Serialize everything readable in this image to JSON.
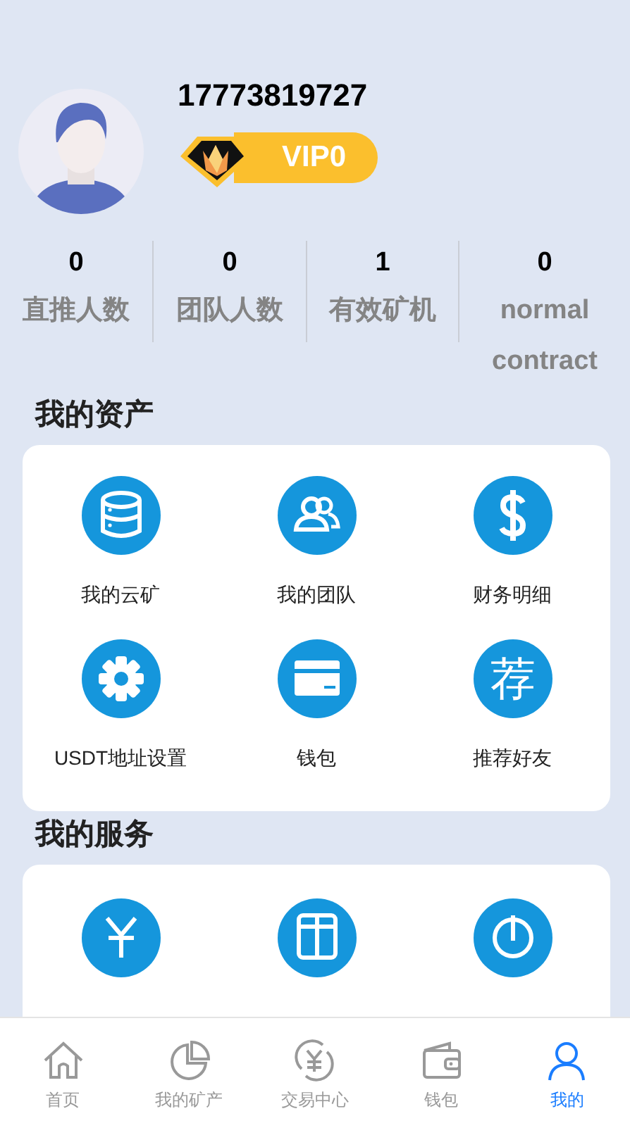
{
  "profile": {
    "phone": "17773819727",
    "vip": "VIP0"
  },
  "stats": [
    {
      "value": "0",
      "label": "直推人数"
    },
    {
      "value": "0",
      "label": "团队人数"
    },
    {
      "value": "1",
      "label": "有效矿机"
    },
    {
      "value": "0",
      "label": "normal contract"
    }
  ],
  "assets": {
    "title": "我的资产",
    "items": [
      {
        "label": "我的云矿"
      },
      {
        "label": "我的团队"
      },
      {
        "label": "财务明细"
      },
      {
        "label": "USDT地址设置"
      },
      {
        "label": "钱包"
      },
      {
        "label": "推荐好友",
        "icon_text": "荐"
      }
    ]
  },
  "services": {
    "title": "我的服务"
  },
  "tabbar": [
    {
      "label": "首页",
      "selected": false
    },
    {
      "label": "我的矿产",
      "selected": false
    },
    {
      "label": "交易中心",
      "selected": false
    },
    {
      "label": "钱包",
      "selected": false
    },
    {
      "label": "我的",
      "selected": true
    }
  ]
}
